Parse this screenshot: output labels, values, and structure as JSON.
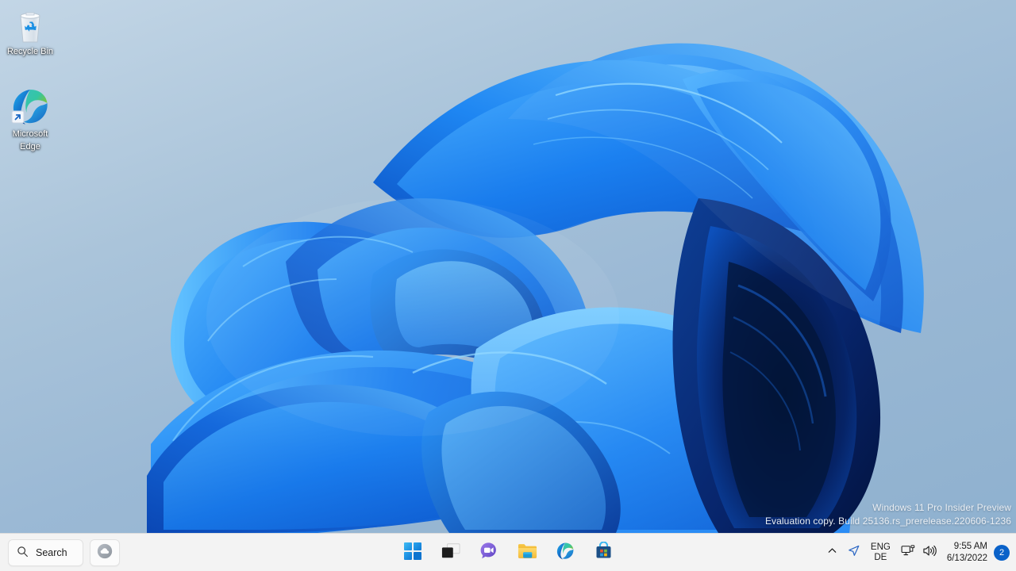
{
  "desktop": {
    "icons": [
      {
        "name": "recycle-bin",
        "label": "Recycle Bin"
      },
      {
        "name": "microsoft-edge",
        "label": "Microsoft\nEdge",
        "label_line1": "Microsoft",
        "label_line2": "Edge"
      }
    ],
    "watermark": {
      "line1": "Windows 11 Pro Insider Preview",
      "line2": "Evaluation copy. Build 25136.rs_prerelease.220606-1236"
    },
    "wallpaper_name": "Windows 11 Bloom"
  },
  "taskbar": {
    "background_color": "#f3f3f3",
    "search": {
      "label": "Search",
      "icon": "search-icon"
    },
    "weather": {
      "icon": "weather-cloud-icon"
    },
    "apps": [
      {
        "name": "start",
        "label": "Start",
        "icon": "windows-logo-icon"
      },
      {
        "name": "task-view",
        "label": "Task view",
        "icon": "task-view-icon"
      },
      {
        "name": "chat",
        "label": "Chat",
        "icon": "chat-bubble-icon"
      },
      {
        "name": "file-explorer",
        "label": "File Explorer",
        "icon": "folder-icon"
      },
      {
        "name": "microsoft-edge",
        "label": "Microsoft Edge",
        "icon": "edge-icon"
      },
      {
        "name": "microsoft-store",
        "label": "Microsoft Store",
        "icon": "store-bag-icon"
      }
    ],
    "tray": {
      "show_hidden_icons": {
        "icon": "chevron-up-icon"
      },
      "location": {
        "icon": "location-arrow-icon"
      },
      "language": {
        "line1": "ENG",
        "line2": "DE"
      },
      "network": {
        "icon": "ethernet-monitor-icon"
      },
      "volume": {
        "icon": "speaker-icon"
      },
      "clock": {
        "time": "9:55 AM",
        "date": "6/13/2022"
      },
      "notifications": {
        "count": "2",
        "color": "#0a62c9"
      }
    }
  }
}
